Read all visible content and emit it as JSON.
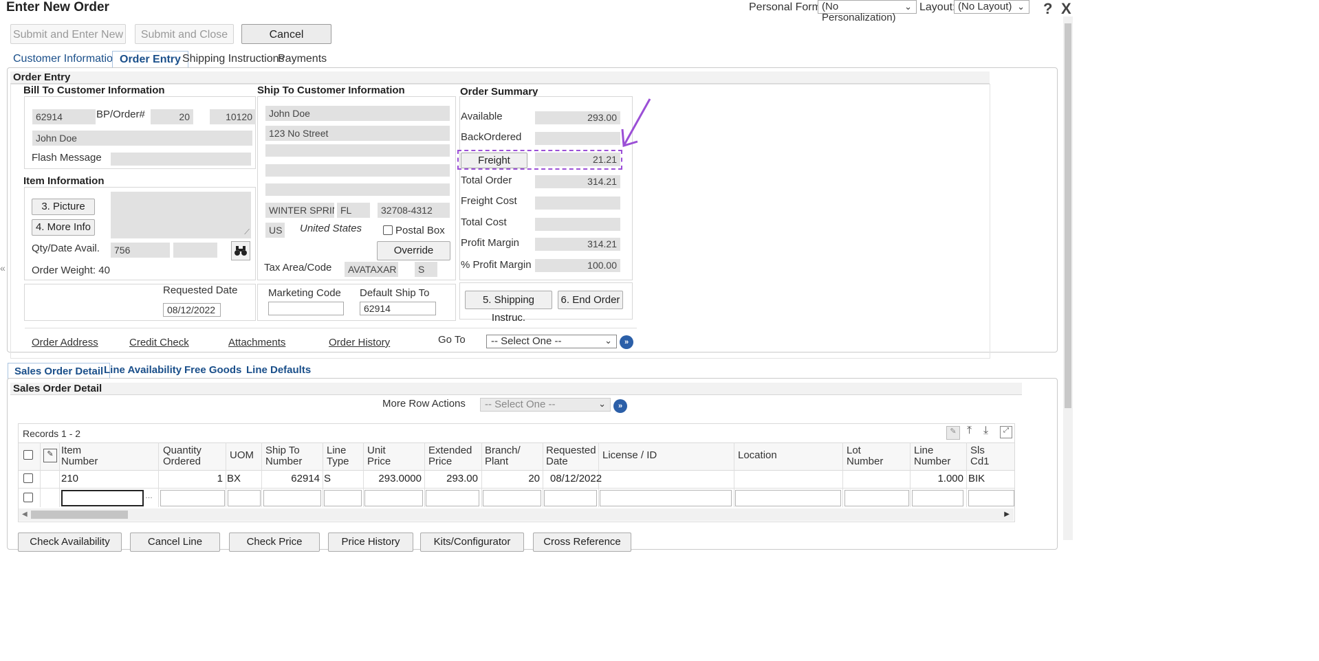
{
  "window": {
    "title": "Enter New Order",
    "personal_form_label": "Personal Form:",
    "personal_form_value": "(No Personalization)",
    "layout_label": "Layout:",
    "layout_value": "(No Layout)",
    "help_icon": "?",
    "close_icon": "X"
  },
  "toolbar": {
    "submit_enter_new": "Submit and Enter New",
    "submit_close": "Submit and Close",
    "cancel": "Cancel"
  },
  "tabs": [
    "Customer Information",
    "Order Entry",
    "Shipping Instructions",
    "Payments"
  ],
  "order_entry": {
    "header": "Order Entry",
    "bill_to": {
      "title": "Bill To Customer Information",
      "customer_no": "62914",
      "bp_order_label": "BP/Order#",
      "bp": "20",
      "order": "10120",
      "name": "John Doe",
      "flash_message_label": "Flash Message",
      "flash_message": ""
    },
    "item_info": {
      "title": "Item Information",
      "picture_button": "3. Picture",
      "more_info_button": "4. More Info",
      "qty_date_label": "Qty/Date Avail.",
      "qty_avail": "756",
      "date_avail": "",
      "order_weight": "Order Weight: 40"
    },
    "requested_date": {
      "label": "Requested Date",
      "value": "08/12/2022"
    },
    "ship_to": {
      "title": "Ship To Customer Information",
      "name": "John Doe",
      "address1": "123 No Street",
      "address2": "",
      "address3": "",
      "address4": "",
      "city": "WINTER SPRING",
      "state": "FL",
      "zip": "32708-4312",
      "country_code": "US",
      "country_name": "United States",
      "postal_box_label": "Postal Box",
      "override_button": "Override",
      "tax_area_label": "Tax Area/Code",
      "tax_area": "AVATAXAR",
      "tax_code": "S",
      "marketing_code_label": "Marketing Code",
      "marketing_code": "",
      "default_ship_to_label": "Default Ship To",
      "default_ship_to": "62914"
    },
    "order_summary": {
      "title": "Order Summary",
      "available_label": "Available",
      "available": "293.00",
      "backordered_label": "BackOrdered",
      "backordered": "",
      "freight_button": "Freight",
      "freight": "21.21",
      "total_order_label": "Total Order",
      "total_order": "314.21",
      "freight_cost_label": "Freight Cost",
      "freight_cost": "",
      "total_cost_label": "Total Cost",
      "total_cost": "",
      "profit_margin_label": "Profit Margin",
      "profit_margin": "314.21",
      "pct_profit_margin_label": "% Profit Margin",
      "pct_profit_margin": "100.00",
      "shipping_instruc_button": "5. Shipping Instruc.",
      "end_order_button": "6. End Order"
    },
    "links": {
      "order_address": "Order Address",
      "credit_check": "Credit Check",
      "attachments": "Attachments",
      "order_history": "Order History",
      "go_to_label": "Go To",
      "go_to_value": "-- Select One --"
    }
  },
  "detail_tabs": [
    "Sales Order Detail",
    "Line Availability",
    "Free Goods",
    "Line Defaults"
  ],
  "sales_detail": {
    "header": "Sales Order Detail",
    "more_row_actions_label": "More Row Actions",
    "more_row_actions_value": "-- Select One --",
    "records": "Records 1 - 2",
    "columns": [
      [
        "Item",
        "Number"
      ],
      [
        "Quantity",
        "Ordered"
      ],
      [
        "UOM",
        ""
      ],
      [
        "Ship To",
        "Number"
      ],
      [
        "Line",
        "Type"
      ],
      [
        "Unit",
        "Price"
      ],
      [
        "Extended",
        "Price"
      ],
      [
        "Branch/",
        "Plant"
      ],
      [
        "Requested",
        "Date"
      ],
      [
        "License / ID",
        ""
      ],
      [
        "Location",
        ""
      ],
      [
        "Lot",
        "Number"
      ],
      [
        "Line",
        "Number"
      ],
      [
        "Sls",
        "Cd1"
      ]
    ],
    "row1": {
      "item": "210",
      "qty": "1",
      "uom": "BX",
      "ship_to": "62914",
      "line_type": "S",
      "unit_price": "293.0000",
      "ext_price": "293.00",
      "branch": "20",
      "req_date": "08/12/2022",
      "line_number": "1.000",
      "sls_cd1": "BIK"
    },
    "bottom_buttons": [
      "Check Availability",
      "Cancel Line",
      "Check Price",
      "Price History",
      "Kits/Configurator",
      "Cross Reference"
    ]
  }
}
